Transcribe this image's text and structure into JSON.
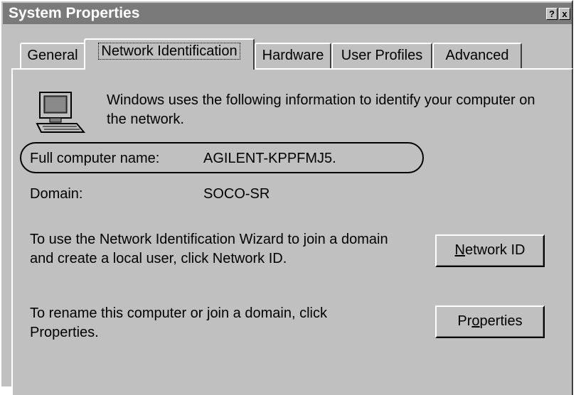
{
  "window": {
    "title": "System Properties",
    "help_button": "?",
    "close_button": "x"
  },
  "tabs": [
    {
      "label": "General",
      "active": false
    },
    {
      "label": "Network Identification",
      "active": true
    },
    {
      "label": "Hardware",
      "active": false
    },
    {
      "label": "User Profiles",
      "active": false
    },
    {
      "label": "Advanced",
      "active": false
    }
  ],
  "panel": {
    "icon": "computer-icon",
    "intro_text": "Windows uses the following information to identify your computer on the network.",
    "full_name_label": "Full computer name:",
    "full_name_value": "AGILENT-KPPFMJ5.",
    "domain_label": "Domain:",
    "domain_value": "SOCO-SR",
    "wizard_text": "To use the Network Identification Wizard to join a domain and create a local user, click Network ID.",
    "network_id_button": {
      "mnemonic": "N",
      "rest": "etwork ID"
    },
    "rename_text": "To rename this computer or join a domain, click Properties.",
    "properties_button": {
      "pre": "Pr",
      "mnemonic": "o",
      "post": "perties"
    }
  }
}
